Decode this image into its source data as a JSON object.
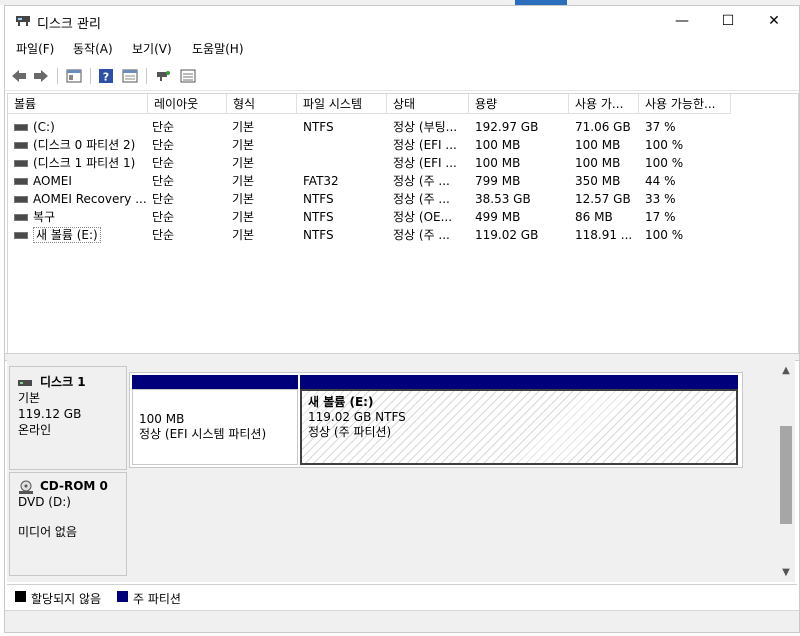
{
  "window": {
    "title": "디스크 관리",
    "minimize": "—",
    "maximize": "☐",
    "close": "✕"
  },
  "menu": [
    "파일(F)",
    "동작(A)",
    "보기(V)",
    "도움말(H)"
  ],
  "toolbar": {
    "icons": [
      "back-icon",
      "forward-icon",
      "console-tree-icon",
      "help-icon",
      "properties-icon",
      "connect-icon",
      "list-view-icon"
    ]
  },
  "volume_table": {
    "headers": [
      "볼륨",
      "레이아웃",
      "형식",
      "파일 시스템",
      "상태",
      "용량",
      "사용 가...",
      "사용 가능한..."
    ],
    "rows": [
      [
        "(C:)",
        "단순",
        "기본",
        "NTFS",
        "정상 (부팅...",
        "192.97 GB",
        "71.06 GB",
        "37 %"
      ],
      [
        "(디스크 0 파티션 2)",
        "단순",
        "기본",
        "",
        "정상 (EFI ...",
        "100 MB",
        "100 MB",
        "100 %"
      ],
      [
        "(디스크 1 파티션 1)",
        "단순",
        "기본",
        "",
        "정상 (EFI ...",
        "100 MB",
        "100 MB",
        "100 %"
      ],
      [
        "AOMEI",
        "단순",
        "기본",
        "FAT32",
        "정상 (주 ...",
        "799 MB",
        "350 MB",
        "44 %"
      ],
      [
        "AOMEI Recovery ...",
        "단순",
        "기본",
        "NTFS",
        "정상 (주 ...",
        "38.53 GB",
        "12.57 GB",
        "33 %"
      ],
      [
        "복구",
        "단순",
        "기본",
        "NTFS",
        "정상 (OE...",
        "499 MB",
        "86 MB",
        "17 %"
      ],
      [
        "새 볼륨 (E:)",
        "단순",
        "기본",
        "NTFS",
        "정상 (주 ...",
        "119.02 GB",
        "118.91 ...",
        "100 %"
      ]
    ]
  },
  "disks": [
    {
      "name": "디스크 1",
      "type": "기본",
      "size": "119.12 GB",
      "status": "온라인",
      "partitions": [
        {
          "title": "",
          "size": "100 MB",
          "status": "정상 (EFI 시스템 파티션)"
        },
        {
          "title": "새 볼륨  (E:)",
          "size": "119.02 GB NTFS",
          "status": "정상 (주 파티션)"
        }
      ]
    },
    {
      "name": "CD-ROM 0",
      "type": "DVD (D:)",
      "status": "미디어 없음"
    }
  ],
  "legend": [
    {
      "label": "할당되지 않음",
      "color": "#000000"
    },
    {
      "label": "주 파티션",
      "color": "#00007a"
    }
  ]
}
